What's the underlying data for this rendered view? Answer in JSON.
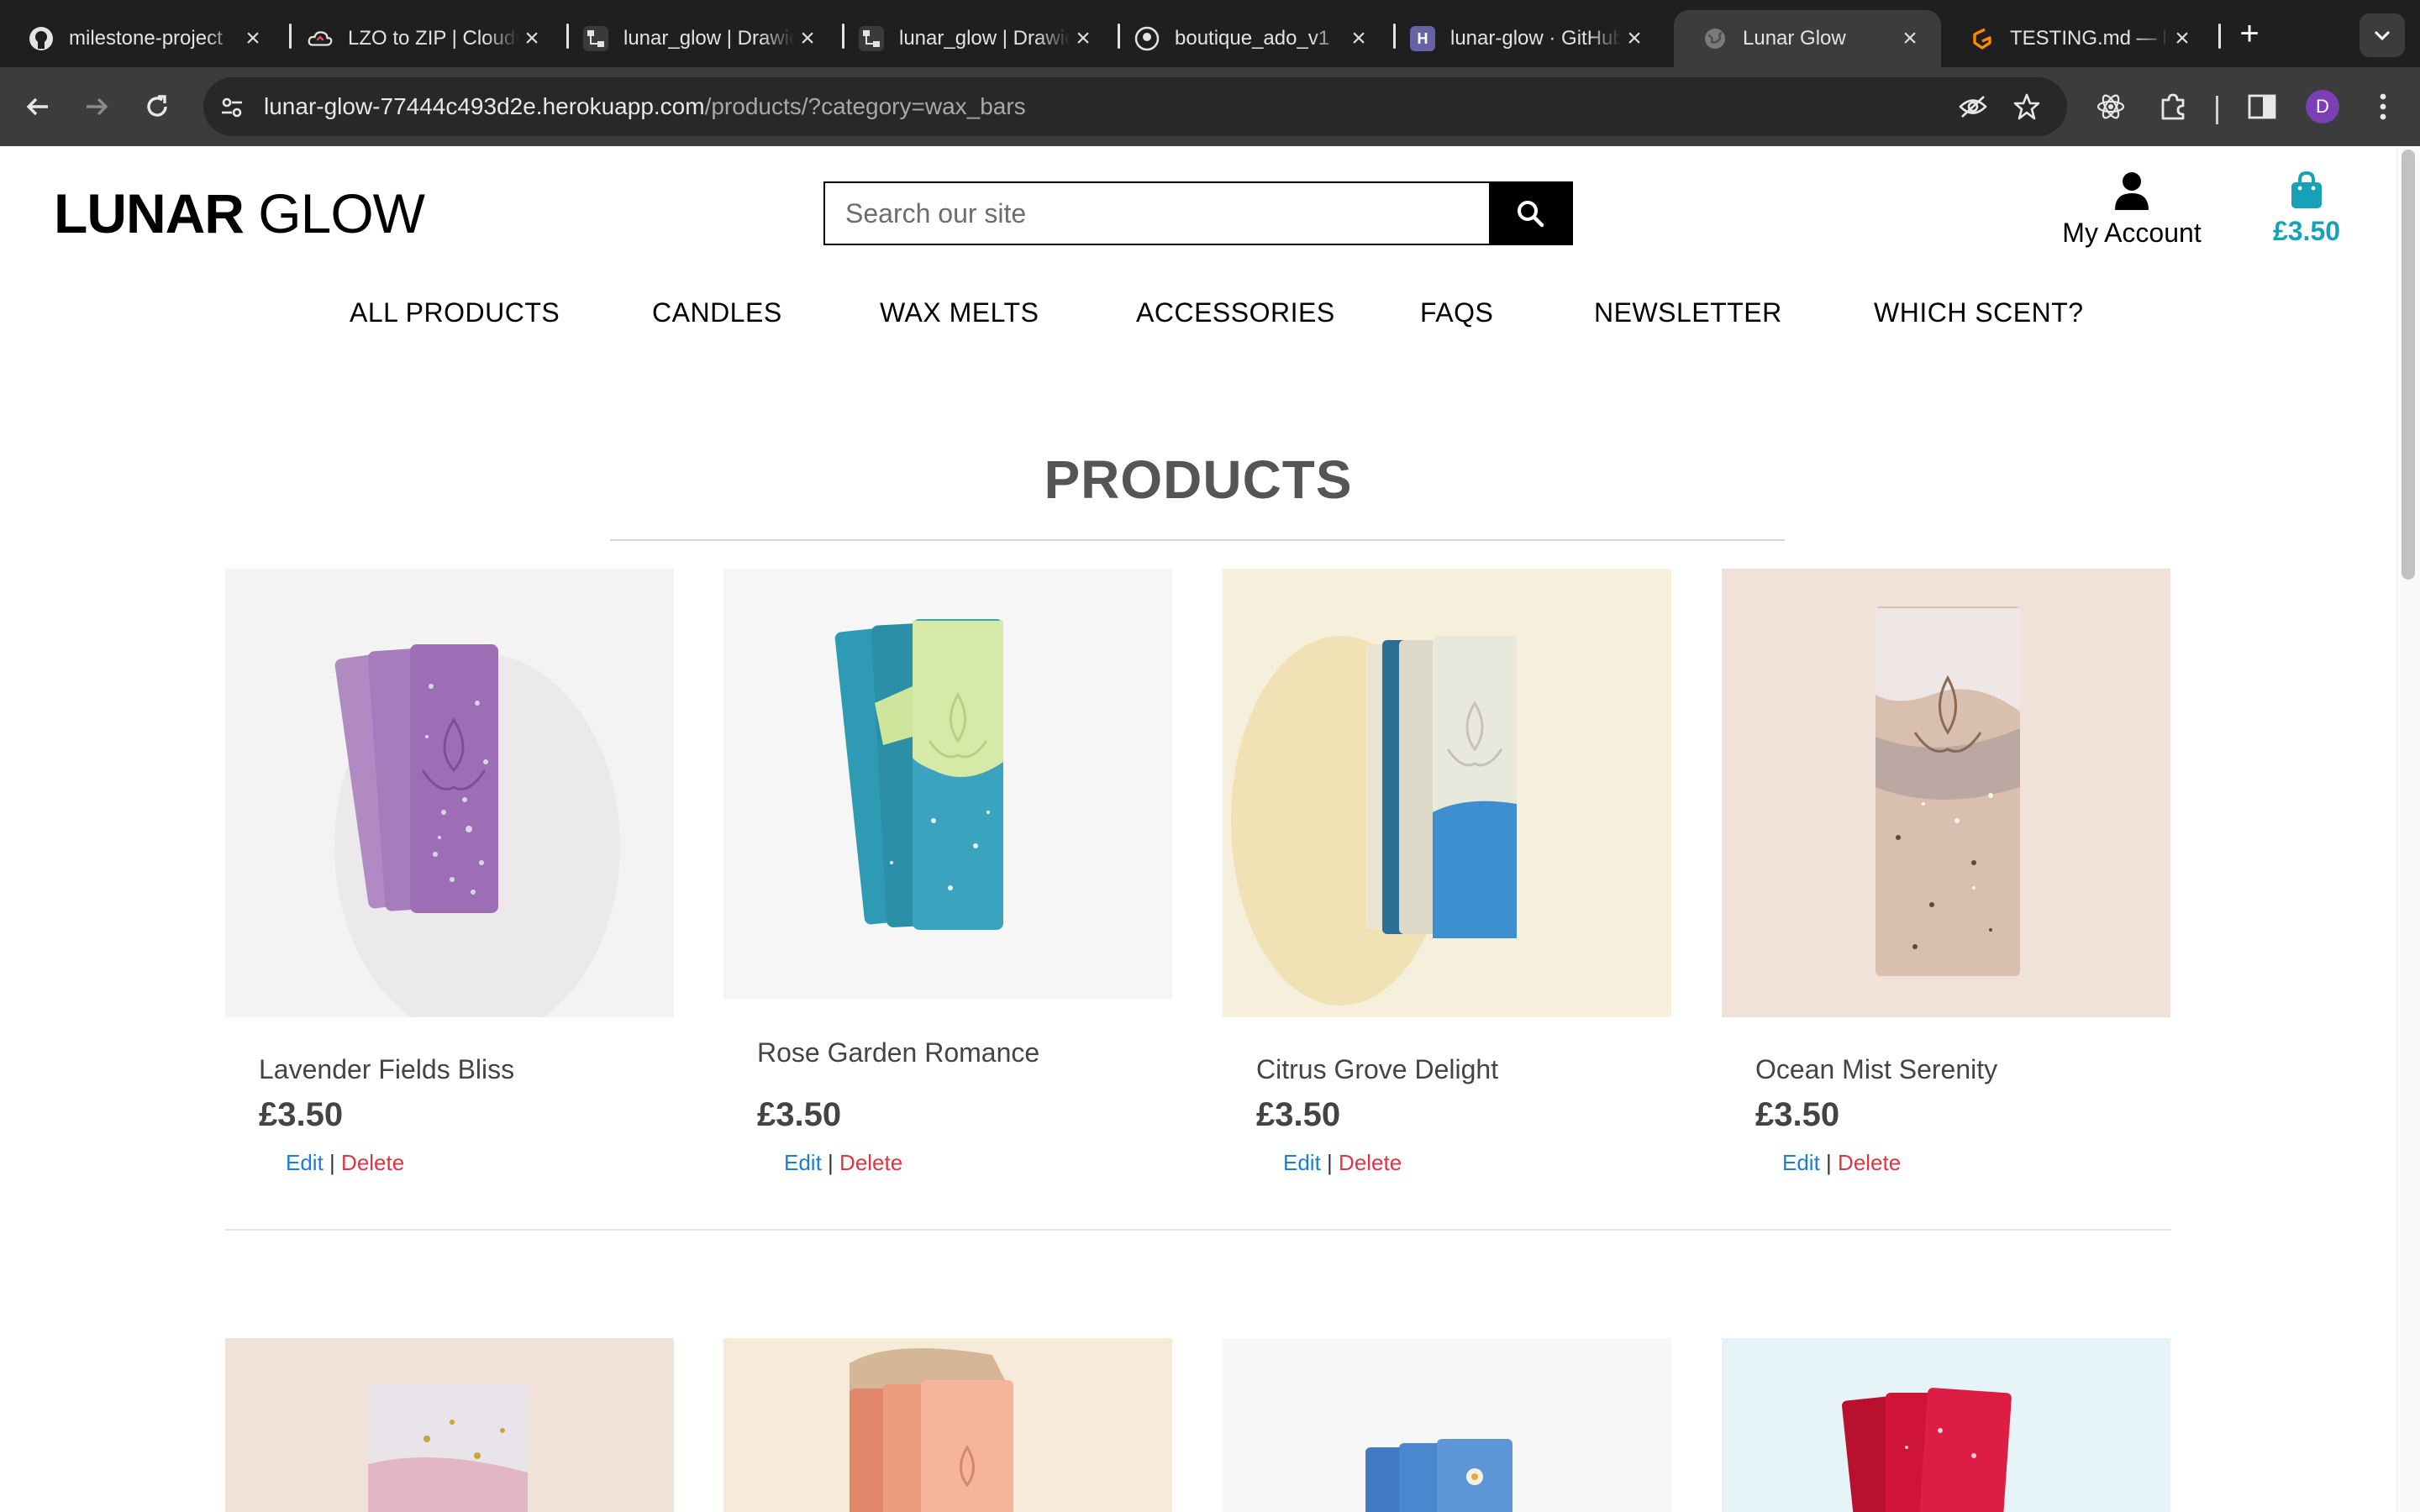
{
  "browser": {
    "tabs": [
      {
        "title": "milestone-project",
        "icon": "github-icon",
        "active": false
      },
      {
        "title": "LZO to ZIP | CloudConvert",
        "icon": "cloudconvert-icon",
        "active": false
      },
      {
        "title": "lunar_glow | Drawio",
        "icon": "drawio-icon",
        "active": false
      },
      {
        "title": "lunar_glow | Drawio",
        "icon": "drawio-icon",
        "active": false
      },
      {
        "title": "boutique_ado_v1",
        "icon": "github-icon",
        "active": false
      },
      {
        "title": "lunar-glow · GitHub",
        "icon": "heroku-icon",
        "active": false
      },
      {
        "title": "Lunar Glow",
        "icon": "globe-icon",
        "active": true
      },
      {
        "title": "TESTING.md — lunar-glow",
        "icon": "gitpod-icon",
        "active": false
      }
    ],
    "url_host": "lunar-glow-77444c493d2e.herokuapp.com",
    "url_path": "/products/?category=wax_bars",
    "profile_initial": "D"
  },
  "site": {
    "logo_bold": "LUNAR",
    "logo_light": " GLOW",
    "search_placeholder": "Search our site",
    "account_label": "My Account",
    "bag_total": "£3.50",
    "nav": [
      "ALL PRODUCTS",
      "CANDLES",
      "WAX MELTS",
      "ACCESSORIES",
      "FAQS",
      "NEWSLETTER",
      "WHICH SCENT?"
    ],
    "page_title": "PRODUCTS",
    "edit_label": "Edit",
    "separator": "|",
    "delete_label": "Delete",
    "accent_color": "#17a2b8"
  },
  "products": [
    {
      "name": "Lavender Fields Bliss",
      "price": "£3.50"
    },
    {
      "name": "Rose Garden Romance",
      "price": "£3.50"
    },
    {
      "name": "Citrus Grove Delight",
      "price": "£3.50"
    },
    {
      "name": "Ocean Mist Serenity",
      "price": "£3.50"
    }
  ]
}
